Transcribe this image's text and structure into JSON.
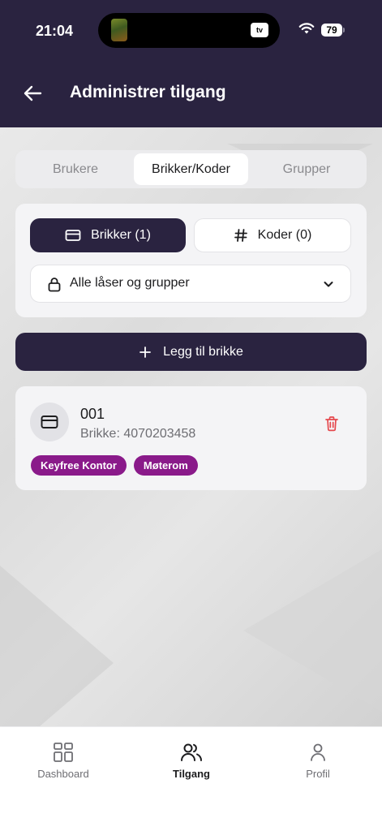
{
  "status_bar": {
    "time": "21:04",
    "tv_label": "tv",
    "battery": "79"
  },
  "header": {
    "title": "Administrer tilgang"
  },
  "tabs": [
    {
      "label": "Brukere",
      "active": false
    },
    {
      "label": "Brikker/Koder",
      "active": true
    },
    {
      "label": "Grupper",
      "active": false
    }
  ],
  "filters": {
    "cards_label": "Brikker (1)",
    "codes_label": "Koder (0)",
    "lock_select_value": "Alle låser og grupper"
  },
  "add_button": {
    "label": "Legg til brikke"
  },
  "keys": [
    {
      "name": "001",
      "subtitle": "Brikke: 4070203458",
      "tags": [
        "Keyfree Kontor",
        "Møterom"
      ]
    }
  ],
  "bottom_nav": [
    {
      "label": "Dashboard",
      "icon": "grid-icon",
      "active": false
    },
    {
      "label": "Tilgang",
      "icon": "users-icon",
      "active": true
    },
    {
      "label": "Profil",
      "icon": "user-icon",
      "active": false
    }
  ],
  "colors": {
    "primary": "#2a2340",
    "tag": "#8a1a8a",
    "danger": "#e5484d"
  }
}
